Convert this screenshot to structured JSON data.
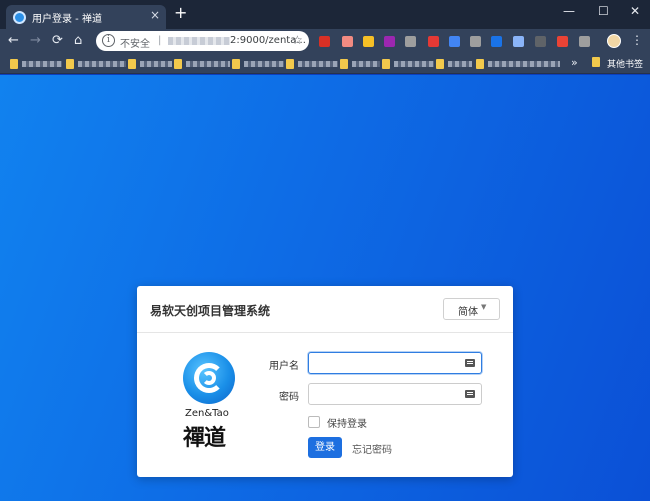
{
  "browser": {
    "tab_title": "用户登录 - 禅道",
    "tab_close": "×",
    "new_tab": "+",
    "window": {
      "minimize": "—",
      "maximize": "☐",
      "close": "✕"
    },
    "nav": {
      "back": "←",
      "forward": "→",
      "reload": "⟳",
      "home": "⌂"
    },
    "address": {
      "security_label": "不安全",
      "separator": "|",
      "url_visible": "2:9000/zenta..."
    },
    "bookmarks_more": "»",
    "bookmarks_other": "其他书签",
    "menu": "⋮",
    "extension_colors": [
      "#d93025",
      "#f28b82",
      "#f6c026",
      "#9c27b0",
      "#e53935",
      "#4285f4",
      "#1a73e8",
      "#3367d6",
      "#8ab4f8",
      "#9e9e9e",
      "#ea4335",
      "#5f6368"
    ]
  },
  "login": {
    "system_title": "易软天创项目管理系统",
    "language_selected": "简体",
    "username_label": "用户名",
    "password_label": "密码",
    "username_value": "",
    "password_value": "",
    "keep_login_label": "保持登录",
    "keep_login_checked": false,
    "login_button": "登录",
    "forgot_password": "忘记密码",
    "brand_en": "Zen&Tao",
    "brand_cn": "禪道"
  },
  "colors": {
    "accent": "#1d6fe0",
    "background_start": "#1182ef",
    "background_end": "#0b50d6"
  }
}
